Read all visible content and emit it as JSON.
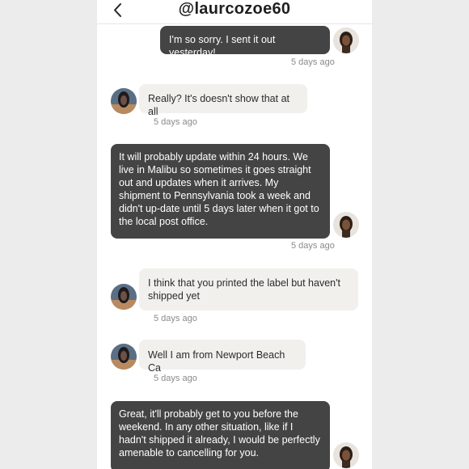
{
  "header": {
    "title": "@laurcozoe60"
  },
  "messages": [
    {
      "side": "sent",
      "text": "I'm so sorry. I sent it out yesterday!",
      "time": "5 days ago"
    },
    {
      "side": "received",
      "text": "Really? It's doesn't show that at all",
      "time": "5 days ago"
    },
    {
      "side": "sent",
      "text": "It will probably update within 24 hours. We live in Malibu so sometimes it goes straight out and updates when it arrives. My shipment to Pennsylvania took a week and didn't up-date until 5 days later when it got to the local post office.",
      "time": "5 days ago"
    },
    {
      "side": "received",
      "text": "I think that you printed the label but haven't shipped yet",
      "time": "5 days ago"
    },
    {
      "side": "received",
      "text": "Well I am from Newport Beach Ca",
      "time": "5 days ago"
    },
    {
      "side": "sent",
      "text": "Great, it'll probably get to you before the weekend. In any other situation, like if I hadn't shipped it already, I would be perfectly amenable to cancelling for you.",
      "time": ""
    }
  ],
  "icons": {
    "back": "chevron-left-icon",
    "sender_avatar": "user-avatar",
    "recipient_avatar": "contact-avatar"
  },
  "colors": {
    "sent_bubble": "#444444",
    "received_bubble": "#f2f0ed",
    "timestamp": "#8a8a8a"
  }
}
